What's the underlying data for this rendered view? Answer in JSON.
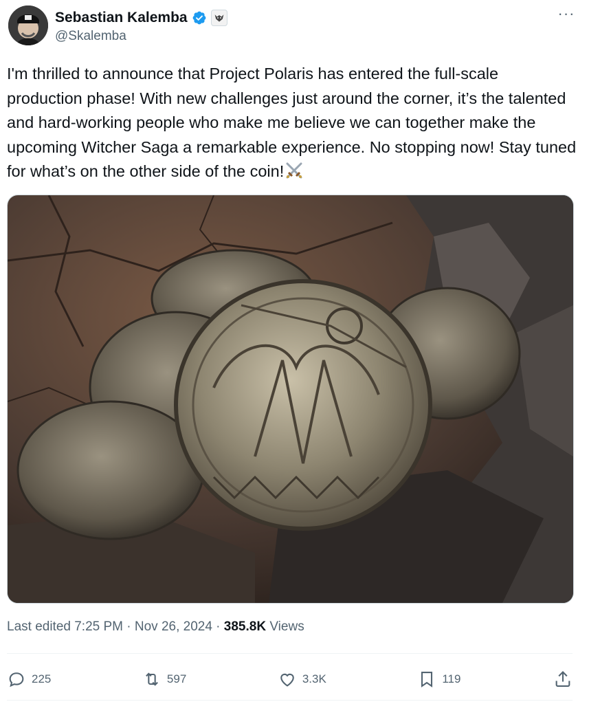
{
  "author": {
    "display_name": "Sebastian Kalemba",
    "handle": "@Skalemba",
    "avatar_icon": "profile-photo",
    "verified_icon": "verified-badge-icon",
    "affiliation_icon": "witcher-wolf-icon"
  },
  "more_icon": "···",
  "tweet": {
    "text": "I'm thrilled to announce that Project Polaris has entered the full-scale production phase! With new challenges just around the corner, it’s the talented and hard-working people who make me believe we can together make the upcoming Witcher Saga a remarkable experience. No stopping now! Stay tuned for what’s on the other side of the coin!",
    "emoji": "crossed-swords-icon"
  },
  "media": {
    "type": "photo",
    "subject": "witcher-coins-photo"
  },
  "meta": {
    "edited_label": "Last edited 7:25 PM · Nov 26, 2024 · ",
    "views_count": "385.8K",
    "views_label": " Views"
  },
  "actions": {
    "replies": "225",
    "reposts": "597",
    "likes": "3.3K",
    "bookmarks": "119"
  },
  "colors": {
    "text_primary": "#0f1419",
    "text_secondary": "#536471",
    "verified": "#1d9bf0",
    "border": "#cfd9de"
  }
}
